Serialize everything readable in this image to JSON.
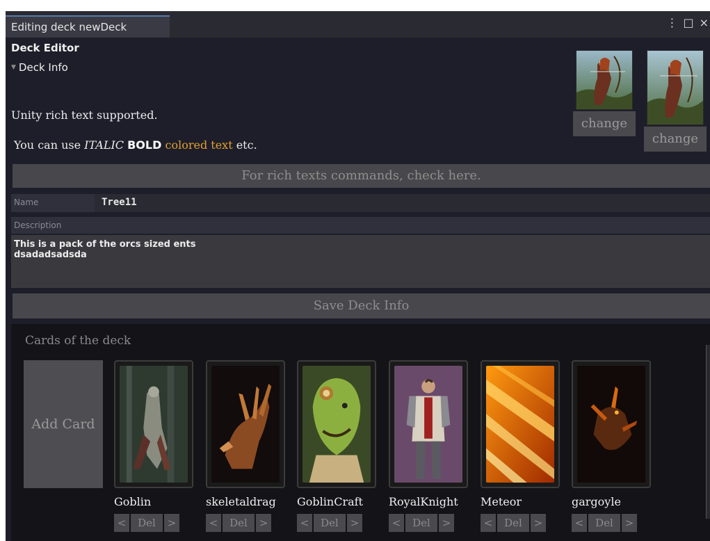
{
  "window": {
    "tab_title": "Editing deck newDeck",
    "menu_glyph": "⋮",
    "maximize_glyph": "□",
    "close_glyph": "×"
  },
  "editor": {
    "title": "Deck Editor",
    "foldout_label": "Deck Info",
    "foldout_icon": "triangle-down-icon"
  },
  "rich_text": {
    "line1": "Unity rich text supported.",
    "line2_prefix": "You can use ",
    "line2_italic": "ITALIC",
    "line2_bold": "BOLD",
    "line2_colored": "colored text",
    "line2_suffix": " etc.",
    "colored_color": "#e0a030",
    "help_button": "For rich texts commands, check here."
  },
  "artwork": [
    {
      "change_label": "change"
    },
    {
      "change_label": "change"
    }
  ],
  "fields": {
    "name_label": "Name",
    "name_value": "Tree11",
    "description_label": "Description",
    "description_value": "This is a pack of the orcs sized ents\ndsadadsadsda"
  },
  "save_button": "Save Deck Info",
  "cards": {
    "title": "Cards of the deck",
    "add_label": "Add Card",
    "items": [
      {
        "name": "Goblin",
        "prev": "<",
        "del": "Del",
        "next": ">"
      },
      {
        "name": "skeletaldrag",
        "prev": "<",
        "del": "Del",
        "next": ">"
      },
      {
        "name": "GoblinCraft",
        "prev": "<",
        "del": "Del",
        "next": ">"
      },
      {
        "name": "RoyalKnight",
        "prev": "<",
        "del": "Del",
        "next": ">"
      },
      {
        "name": "Meteor",
        "prev": "<",
        "del": "Del",
        "next": ">"
      },
      {
        "name": "gargoyle",
        "prev": "<",
        "del": "Del",
        "next": ">"
      }
    ]
  },
  "colors": {
    "window_bg": "#1e1e2a",
    "button_bg": "#48484c",
    "panel_bg": "#141418"
  }
}
